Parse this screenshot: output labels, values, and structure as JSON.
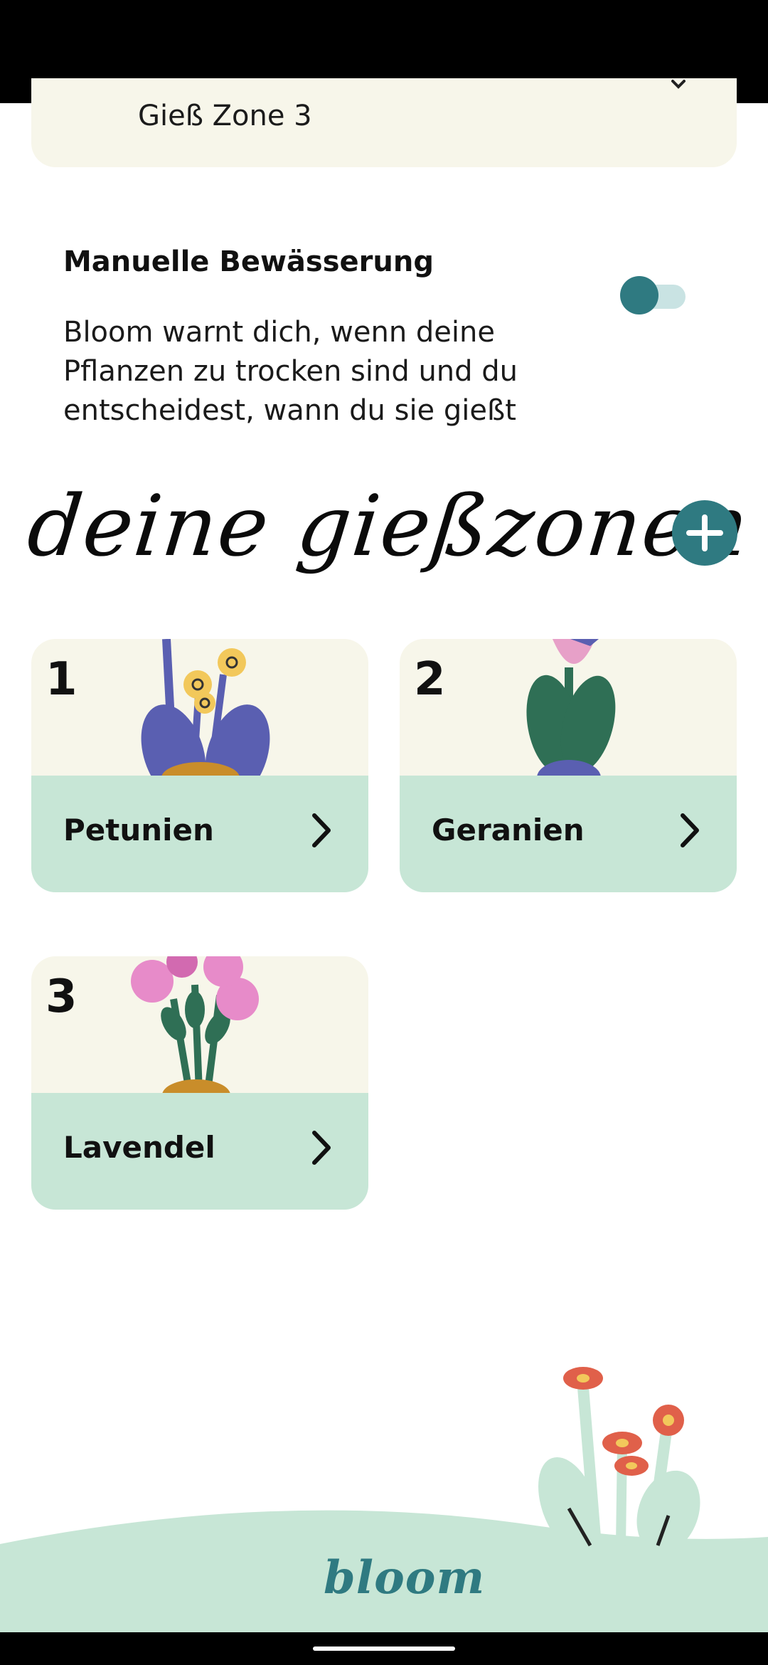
{
  "zone_selector": {
    "label": "Gieß Zone 3"
  },
  "manual_watering": {
    "title": "Manuelle Bewässerung",
    "description": "Bloom warnt dich, wenn deine Pflanzen zu trocken sind und du entscheidest, wann du sie gießt",
    "enabled": false
  },
  "zones_section": {
    "title": "deine gießzonen",
    "add_icon": "plus-icon"
  },
  "zones": [
    {
      "number": "1",
      "name": "Petunien",
      "icon": "chevron-right-icon"
    },
    {
      "number": "2",
      "name": "Geranien",
      "icon": "chevron-right-icon"
    },
    {
      "number": "3",
      "name": "Lavendel",
      "icon": "chevron-right-icon"
    }
  ],
  "footer": {
    "logo": "bloom"
  },
  "colors": {
    "accent": "#2f7a81",
    "card": "#f7f6ea",
    "tile_footer": "#c7e6d6"
  }
}
